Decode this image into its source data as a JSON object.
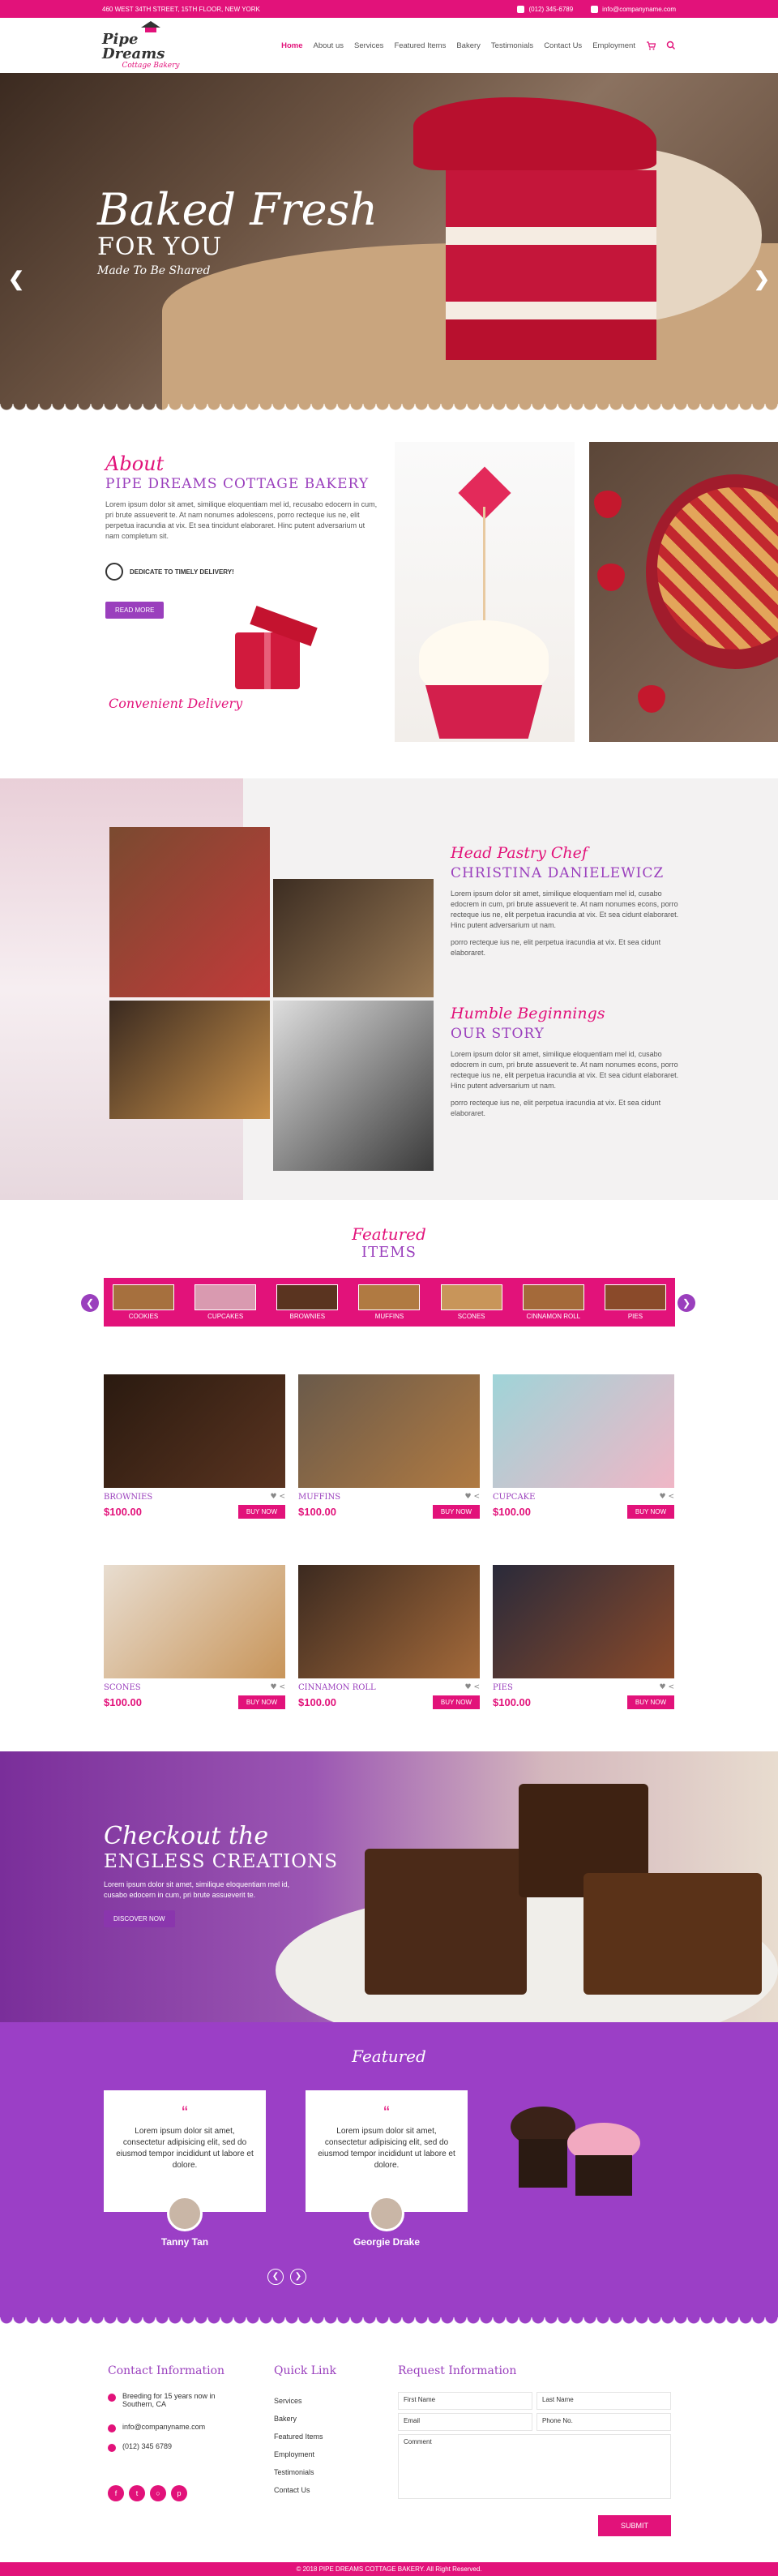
{
  "topbar": {
    "address": "460 WEST 34TH STREET, 15TH FLOOR, NEW YORK",
    "phone": "(012) 345-6789",
    "email": "info@companyname.com"
  },
  "header": {
    "logo_title": "Pipe Dreams",
    "logo_sub": "Cottage Bakery",
    "nav": [
      "Home",
      "About us",
      "Services",
      "Featured Items",
      "Bakery",
      "Testimonials",
      "Contact Us",
      "Employment"
    ]
  },
  "hero": {
    "line1": "Baked Fresh",
    "line2": "FOR YOU",
    "line3": "Made To Be Shared"
  },
  "about": {
    "script": "About",
    "title": "PIPE DREAMS COTTAGE BAKERY",
    "body": "Lorem ipsum dolor sit amet, similique eloquentiam mel id, recusabo edocern in cum, pri brute assueverit te. At nam nonumes adolescens, porro recteque ius ne, elit perpetua iracundia at vix. Et sea tincidunt elaboraret. Hinc putent adversarium ut nam completum sit.",
    "timely": "DEDICATE TO TIMELY DELIVERY!",
    "read_more": "READ MORE",
    "convenient": "Convenient Delivery"
  },
  "chef": {
    "script": "Head Pastry Chef",
    "name": "CHRISTINA DANIELEWICZ",
    "p1": "Lorem ipsum dolor sit amet, similique eloquentiam mel id, cusabo edocrem in cum, pri brute assueverit te. At nam nonumes econs, porro recteque ius ne, elit perpetua iracundia at vix. Et sea cidunt elaboraret. Hinc putent adversarium ut nam.",
    "p2": "porro recteque ius ne, elit perpetua iracundia at vix. Et sea cidunt elaboraret.",
    "script2": "Humble Beginnings",
    "title2": "OUR STORY",
    "p3": "Lorem ipsum dolor sit amet, similique eloquentiam mel id, cusabo edocrem in cum, pri brute assueverit te. At nam nonumes econs, porro recteque ius ne, elit perpetua iracundia at vix. Et sea cidunt elaboraret. Hinc putent adversarium ut nam.",
    "p4": "porro recteque ius ne, elit perpetua iracundia at vix. Et sea cidunt elaboraret."
  },
  "featured": {
    "script": "Featured",
    "title": "ITEMS",
    "categories": [
      "COOKIES",
      "CUPCAKES",
      "BROWNIES",
      "MUFFINS",
      "SCONES",
      "CINNAMON ROLL",
      "PIES"
    ],
    "buy_label": "BUY NOW",
    "products": [
      {
        "name": "BROWNIES",
        "price": "$100.00",
        "color": "#5a3420"
      },
      {
        "name": "MUFFINS",
        "price": "$100.00",
        "color": "#b07a42"
      },
      {
        "name": "CUPCAKE",
        "price": "$100.00",
        "color": "#f0b6c6"
      },
      {
        "name": "SCONES",
        "price": "$100.00",
        "color": "#c8955a"
      },
      {
        "name": "CINNAMON ROLL",
        "price": "$100.00",
        "color": "#a46a3a"
      },
      {
        "name": "PIES",
        "price": "$100.00",
        "color": "#8a4a2a"
      }
    ]
  },
  "creations": {
    "script": "Checkout the",
    "title": "ENGLESS CREATIONS",
    "body": "Lorem ipsum dolor sit amet, similique eloquentiam mel id, cusabo edocern in cum, pri brute assueverit te.",
    "button": "DISCOVER NOW"
  },
  "testimonials": {
    "script": "Featured",
    "items": [
      {
        "text": "Lorem ipsum dolor sit amet, consectetur adipisicing elit, sed do eiusmod tempor incididunt ut labore et dolore.",
        "name": "Tanny Tan"
      },
      {
        "text": "Lorem ipsum dolor sit amet, consectetur adipisicing elit, sed do eiusmod tempor incididunt ut labore et dolore.",
        "name": "Georgie Drake"
      }
    ]
  },
  "footer": {
    "contact_head": "Contact Information",
    "address": "Breeding for 15 years now in Southern, CA",
    "email": "info@companyname.com",
    "phone": "(012) 345 6789",
    "quick_head": "Quick Link",
    "quick": [
      "Services",
      "Bakery",
      "Featured Items",
      "Employment",
      "Testimonials",
      "Contact Us"
    ],
    "request_head": "Request Information",
    "first_name": "First Name",
    "last_name": "Last Name",
    "email_label": "Email",
    "phone_label": "Phone No.",
    "comment": "Comment",
    "submit": "SUBMIT",
    "copyright": "© 2018 PIPE DREAMS COTTAGE BAKERY. All Right Reserved."
  },
  "colors": {
    "pink": "#e2127a",
    "purple": "#9a3fbd"
  }
}
